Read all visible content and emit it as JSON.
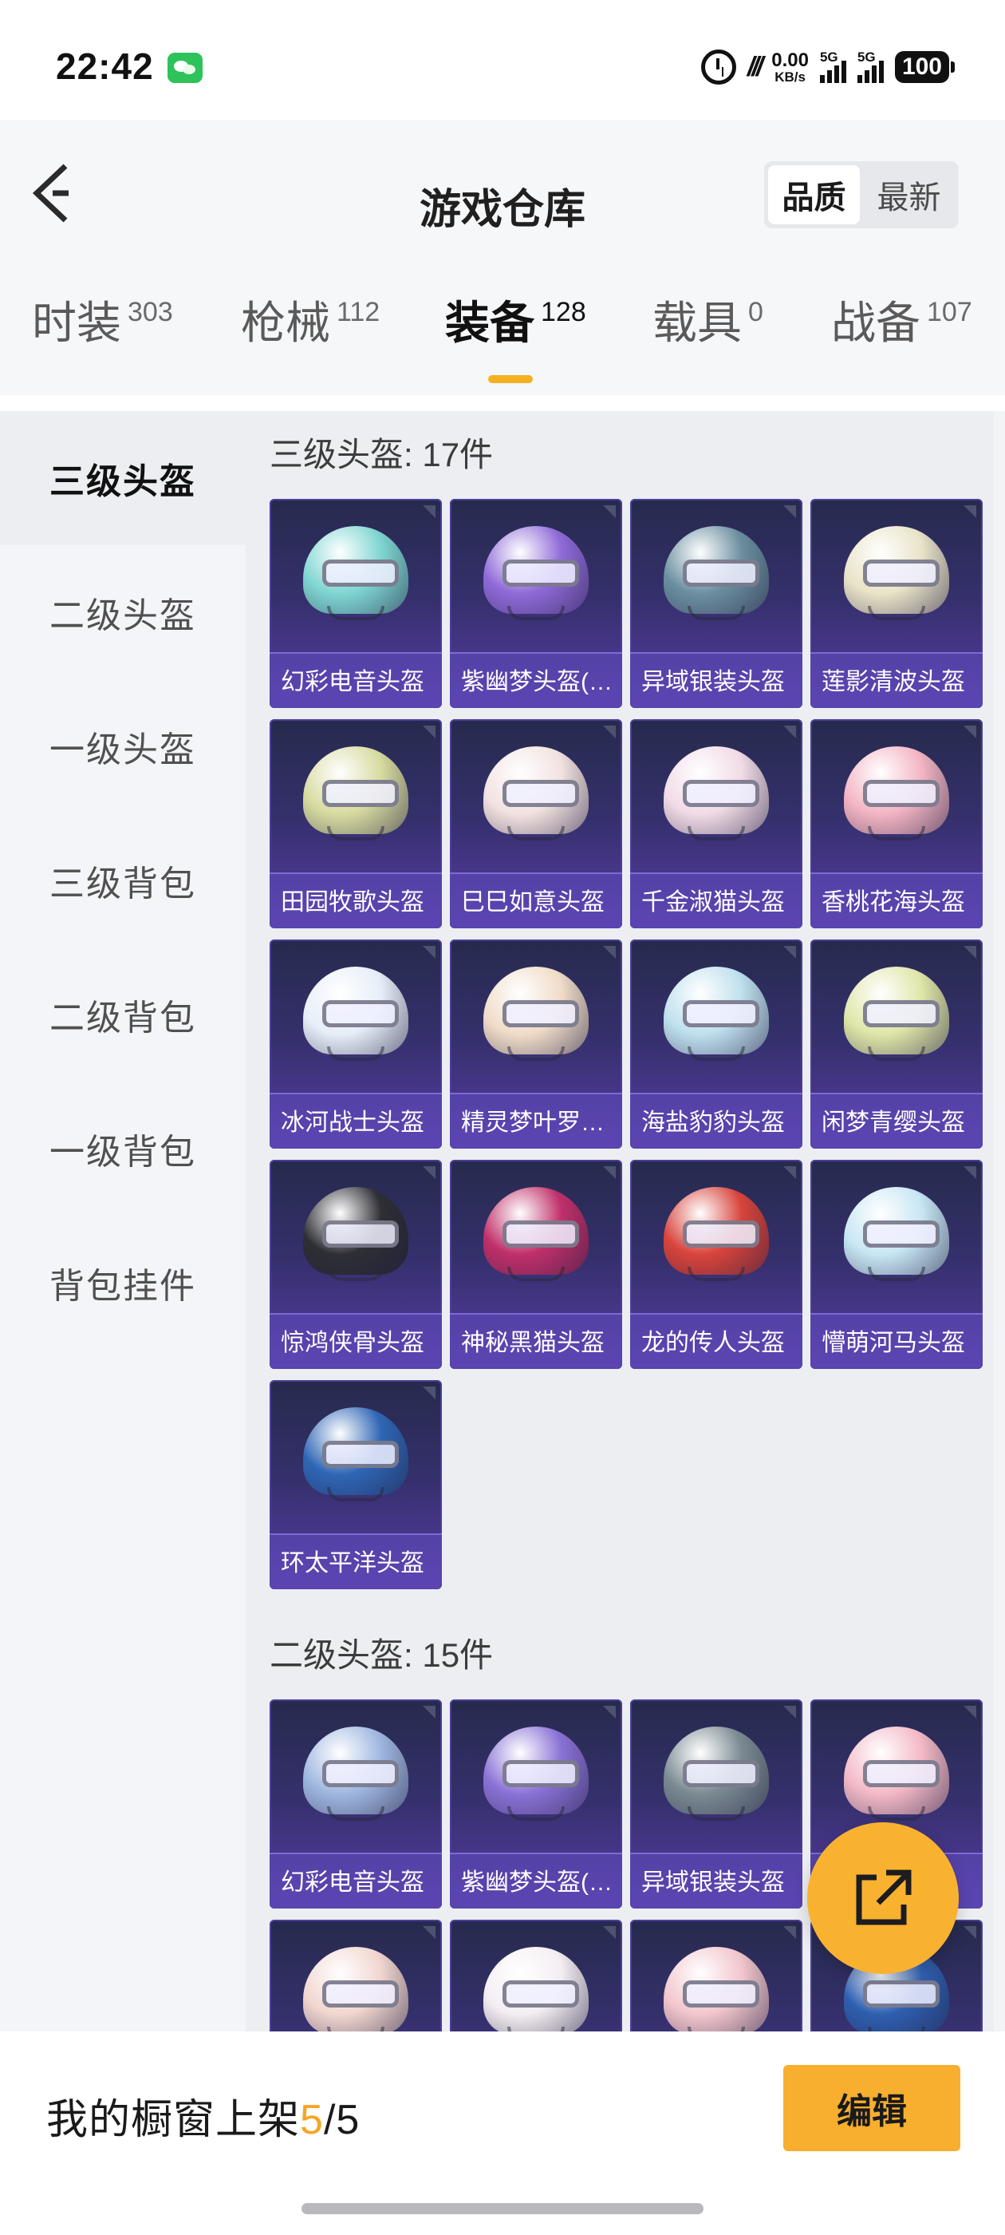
{
  "status_bar": {
    "time": "22:42",
    "speed_value": "0.00",
    "speed_unit": "KB/s",
    "net1": "5G",
    "net2": "5G",
    "battery": "100"
  },
  "header": {
    "title": "游戏仓库",
    "sort_options": [
      "品质",
      "最新"
    ],
    "sort_active": "品质"
  },
  "tabs": [
    {
      "label": "时装",
      "count": "303"
    },
    {
      "label": "枪械",
      "count": "112"
    },
    {
      "label": "装备",
      "count": "128",
      "active": true
    },
    {
      "label": "载具",
      "count": "0"
    },
    {
      "label": "战备",
      "count": "107"
    }
  ],
  "sidebar": {
    "items": [
      "三级头盔",
      "二级头盔",
      "一级头盔",
      "三级背包",
      "二级背包",
      "一级背包",
      "背包挂件"
    ],
    "active": "三级头盔"
  },
  "sections": [
    {
      "title": "三级头盔: 17件",
      "items": [
        {
          "name": "幻彩电音头盔",
          "icon": "helmet-icon",
          "color": "#7fd6d2"
        },
        {
          "name": "紫幽梦头盔(三级)",
          "icon": "helmet-icon",
          "color": "#8f6ad8"
        },
        {
          "name": "异域银装头盔",
          "icon": "helmet-icon",
          "color": "#6b8fa0"
        },
        {
          "name": "莲影清波头盔",
          "icon": "helmet-icon",
          "color": "#e9e3c8"
        },
        {
          "name": "田园牧歌头盔",
          "icon": "helmet-icon",
          "color": "#d8dba0"
        },
        {
          "name": "巳巳如意头盔",
          "icon": "helmet-icon",
          "color": "#f2e2e0"
        },
        {
          "name": "千金淑猫头盔",
          "icon": "helmet-icon",
          "color": "#f1dbe6"
        },
        {
          "name": "香桃花海头盔",
          "icon": "helmet-icon",
          "color": "#f3b5c3"
        },
        {
          "name": "冰河战士头盔",
          "icon": "helmet-icon",
          "color": "#e6eef8"
        },
        {
          "name": "精灵梦叶罗头盔",
          "icon": "helmet-icon",
          "color": "#f0dcc8"
        },
        {
          "name": "海盐豹豹头盔",
          "icon": "helmet-icon",
          "color": "#bfe0ee"
        },
        {
          "name": "闲梦青缨头盔",
          "icon": "helmet-icon",
          "color": "#dfe6a8"
        },
        {
          "name": "惊鸿侠骨头盔",
          "icon": "helmet-icon",
          "color": "#2e2e35"
        },
        {
          "name": "神秘黑猫头盔",
          "icon": "helmet-icon",
          "color": "#c0306a"
        },
        {
          "name": "龙的传人头盔",
          "icon": "helmet-icon",
          "color": "#d8443c"
        },
        {
          "name": "懵萌河马头盔",
          "icon": "helmet-icon",
          "color": "#c7e6f4"
        },
        {
          "name": "环太平洋头盔",
          "icon": "helmet-icon",
          "color": "#2f66b5"
        }
      ]
    },
    {
      "title": "二级头盔: 15件",
      "items": [
        {
          "name": "幻彩电音头盔",
          "icon": "helmet-icon",
          "color": "#9fb7e0"
        },
        {
          "name": "紫幽梦头盔(二级)",
          "icon": "helmet-icon",
          "color": "#8a72d6"
        },
        {
          "name": "异域银装头盔",
          "icon": "helmet-icon",
          "color": "#7a8a92"
        },
        {
          "name": "",
          "icon": "helmet-icon",
          "color": "#f3b9c6"
        },
        {
          "name": "",
          "icon": "helmet-icon",
          "color": "#f1d6cf"
        },
        {
          "name": "",
          "icon": "helmet-icon",
          "color": "#f4eef2"
        },
        {
          "name": "",
          "icon": "helmet-icon",
          "color": "#f2c6cc"
        },
        {
          "name": "",
          "icon": "helmet-icon",
          "color": "#2f5fb0"
        }
      ]
    }
  ],
  "bottom_bar": {
    "label": "我的橱窗上架",
    "current": "5",
    "separator": "/",
    "total": "5",
    "edit_label": "编辑"
  },
  "colors": {
    "accent": "#f8ae2e",
    "card_bg": "#35306d"
  }
}
